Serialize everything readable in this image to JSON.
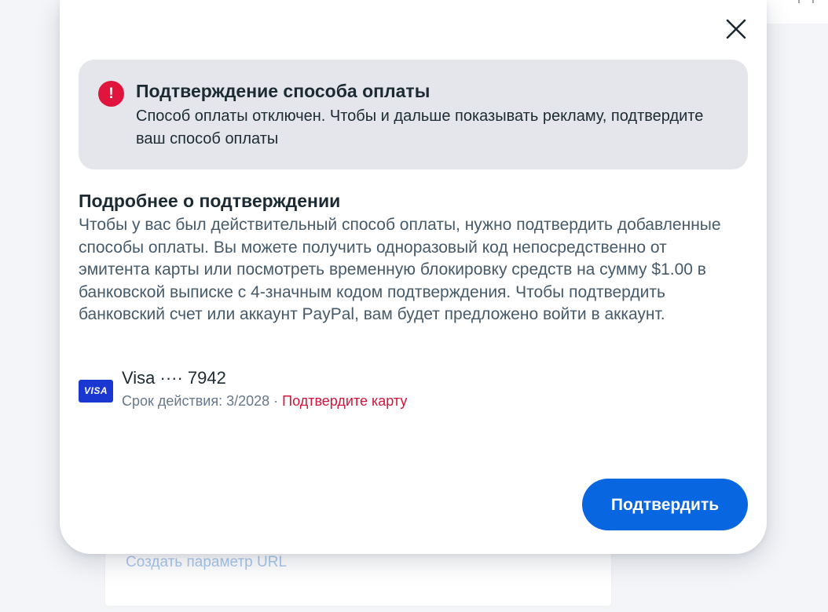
{
  "background": {
    "link_label": "Создать параметр URL"
  },
  "modal": {
    "close_icon": "close-icon",
    "alert": {
      "icon": "error-exclamation-icon",
      "icon_glyph": "!",
      "title": "Подтверждение способа оплаты",
      "text": "Способ оплаты отключен. Чтобы и дальше показывать рекламу, подтвердите ваш способ оплаты"
    },
    "details": {
      "title": "Подробнее о подтверждении",
      "body": "Чтобы у вас был действительный способ оплаты, нужно подтвердить добавленные способы оплаты. Вы можете получить одноразовый код непосредственно от эмитента карты или посмотреть временную блокировку средств на сумму $1.00 в банковской выписке с 4-значным кодом подтверждения. Чтобы подтвердить банковский счет или аккаунт PayPal, вам будет предложено войти в аккаунт."
    },
    "card": {
      "brand_logo_text": "VISA",
      "name": "Visa ···· 7942",
      "expiry": "Срок действия: 3/2028",
      "separator": " · ",
      "confirm_link": "Подтвердите карту"
    },
    "confirm_button": "Подтвердить"
  },
  "colors": {
    "primary": "#0866e0",
    "alert_bg": "#e4e6eb",
    "error": "#e0143c",
    "link_error": "#d5133a",
    "visa_blue": "#1a38d1"
  }
}
